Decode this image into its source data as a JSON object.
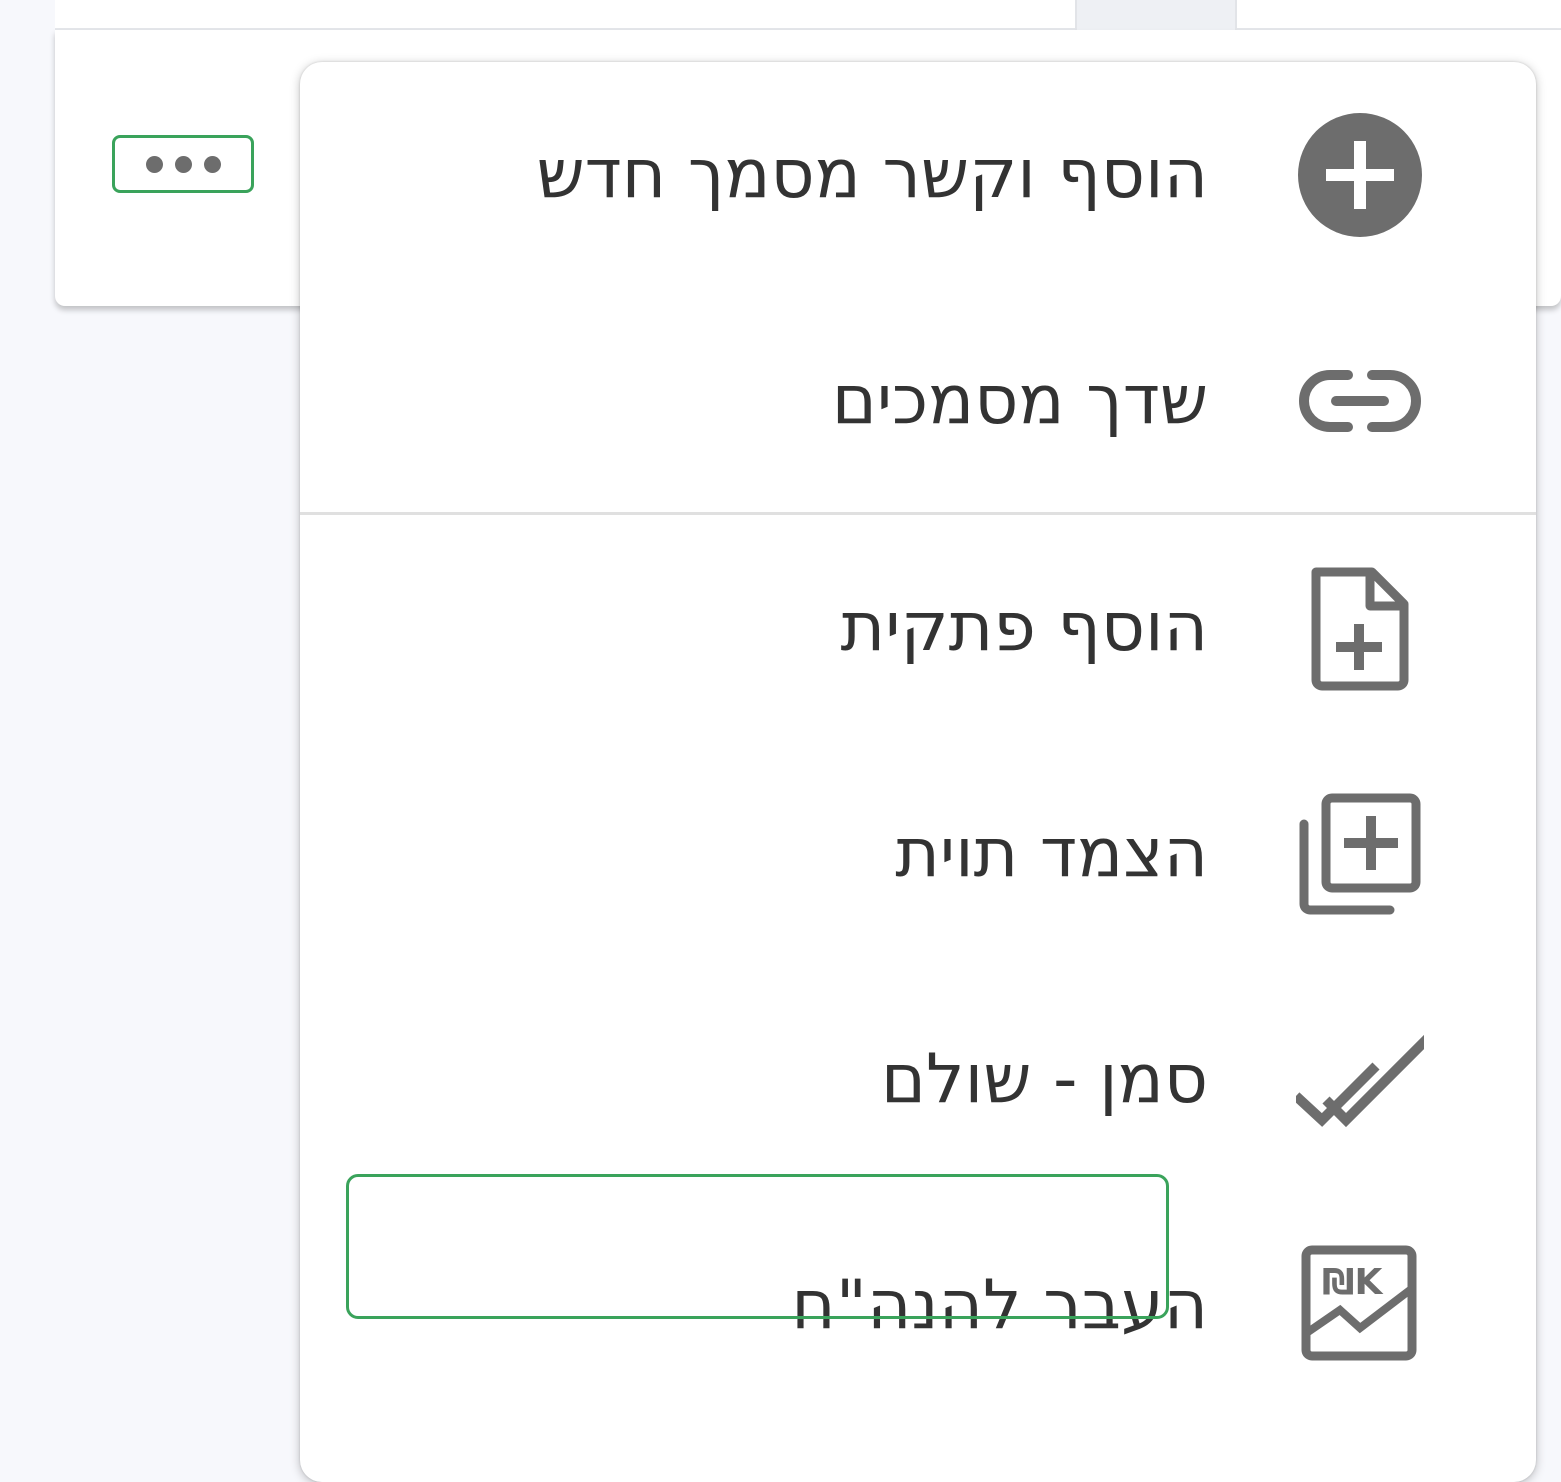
{
  "background": {
    "more_button_dots": [
      "•",
      "•",
      "•"
    ]
  },
  "menu": {
    "items": [
      {
        "label": "הוסף וקשר מסמך חדש",
        "icon": "add-circle-icon"
      },
      {
        "label": "שדך מסמכים",
        "icon": "link-icon"
      },
      {
        "label": "הוסף פתקית",
        "icon": "note-add-icon"
      },
      {
        "label": "הצמד תוית",
        "icon": "library-add-icon"
      },
      {
        "label": "סמן - שולם",
        "icon": "double-check-icon"
      },
      {
        "label": "העבר להנה\"ח",
        "icon": "export-accounting-icon"
      }
    ]
  },
  "colors": {
    "highlight": "#3aa35b",
    "icon": "#6d6d6d",
    "text": "#333333"
  }
}
